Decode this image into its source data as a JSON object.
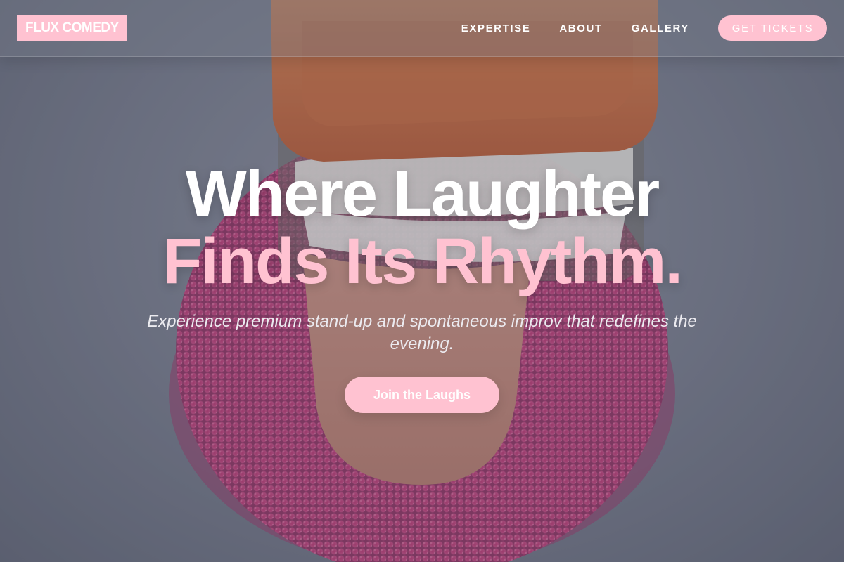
{
  "brand": {
    "logo_text": "FLUX COMEDY",
    "accent_color": "#ffc2d1"
  },
  "nav": {
    "links": [
      {
        "label": "EXPERTISE"
      },
      {
        "label": "ABOUT"
      },
      {
        "label": "GALLERY"
      }
    ],
    "cta_label": "GET TICKETS"
  },
  "hero": {
    "headline_line1": "Where Laughter",
    "headline_line2": "Finds Its Rhythm.",
    "subtitle": "Experience premium stand-up and spontaneous improv that redefines the evening.",
    "cta_label": "Join the Laughs",
    "background_image": "chattering-teeth-toy-photo"
  }
}
